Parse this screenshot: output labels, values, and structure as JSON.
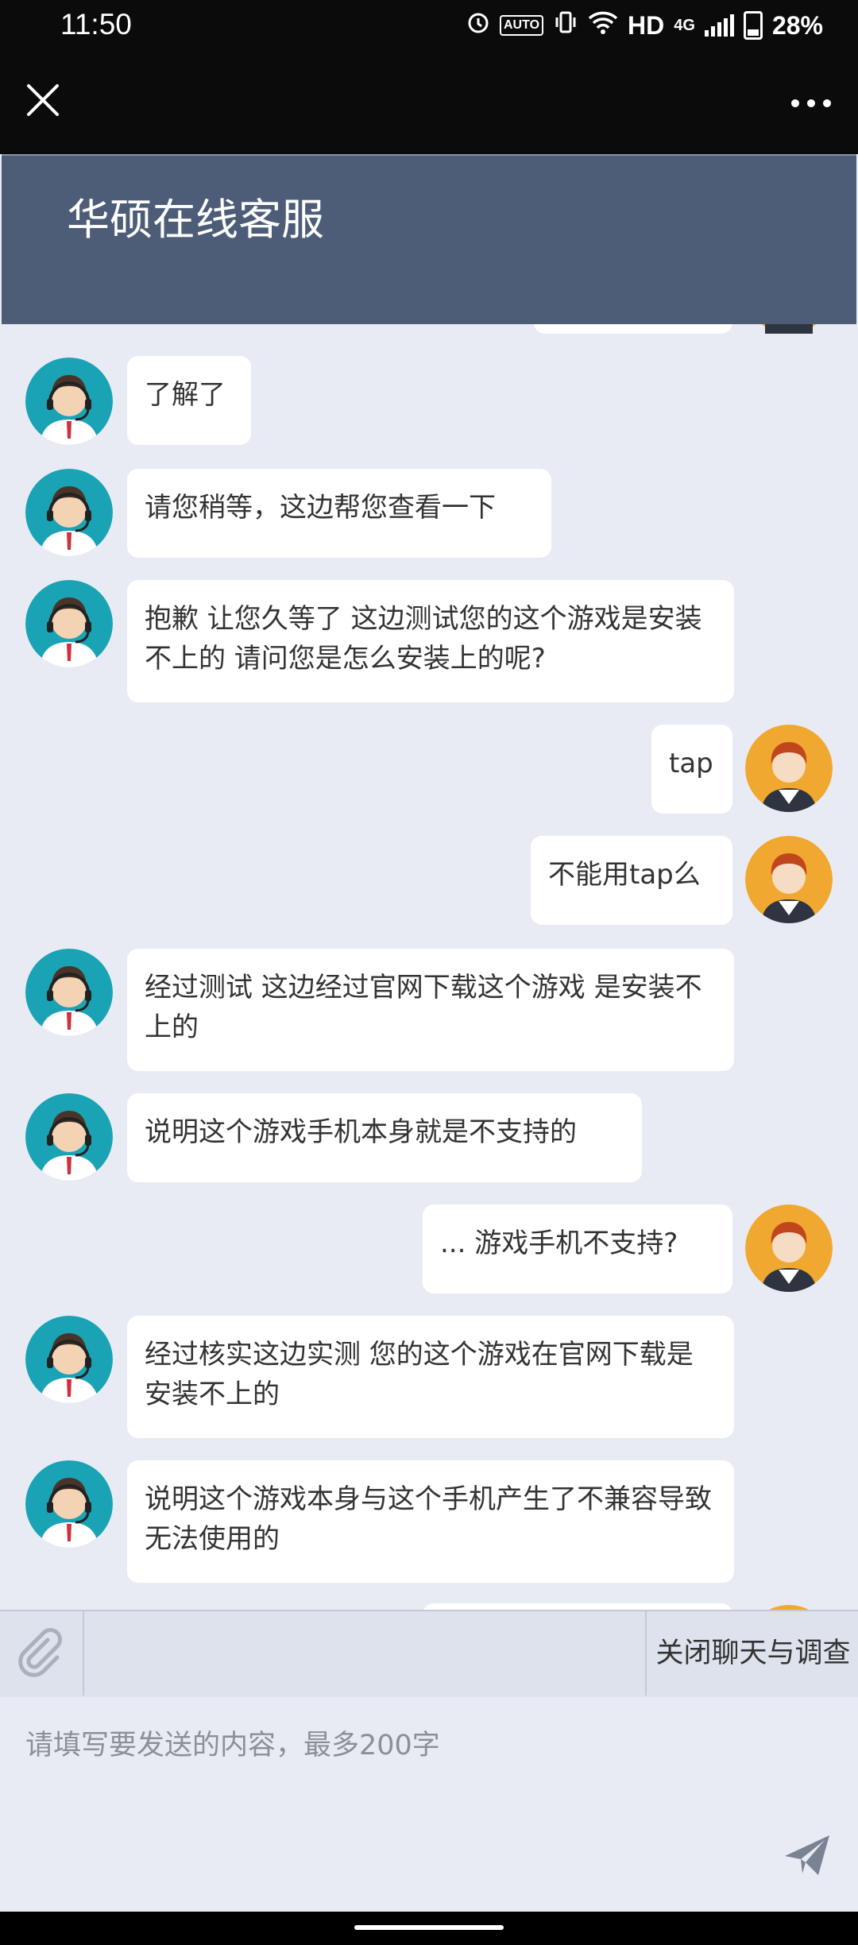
{
  "status_bar": {
    "time": "11:50",
    "icons": [
      "alarm-icon",
      "auto-hz-icon",
      "vibrate-icon",
      "wifi-icon",
      "signal-icon",
      "battery-icon"
    ],
    "auto_label": "AUTO",
    "hd": "HD",
    "network": "4G",
    "battery": "28%"
  },
  "app_bar": {
    "close_icon": "close-icon",
    "more_icon": "more-dots-icon"
  },
  "chat": {
    "title": "华硕在线客服",
    "messages": [
      {
        "from": "agent",
        "text": "了解了"
      },
      {
        "from": "agent",
        "text": "请您稍等，这边帮您查看一下"
      },
      {
        "from": "agent",
        "text": "抱歉 让您久等了 这边测试您的这个游戏是安装不上的 请问您是怎么安装上的呢?"
      },
      {
        "from": "user",
        "text": "tap"
      },
      {
        "from": "user",
        "text": "不能用tap么"
      },
      {
        "from": "agent",
        "text": "经过测试 这边经过官网下载这个游戏 是安装不上的"
      },
      {
        "from": "agent",
        "text": "说明这个游戏手机本身就是不支持的"
      },
      {
        "from": "user",
        "text": "... 游戏手机不支持?"
      },
      {
        "from": "agent",
        "text": "经过核实这边实测 您的这个游戏在官网下载是安装不上的"
      },
      {
        "from": "agent",
        "text": "说明这个游戏本身与这个手机产生了不兼容导致无法使用的"
      }
    ]
  },
  "toolbar": {
    "attach_icon": "paperclip-icon",
    "close_survey_label": "关闭聊天与调查"
  },
  "composer": {
    "placeholder": "请填写要发送的内容，最多200字",
    "send_icon": "send-icon"
  },
  "colors": {
    "header": "#4d5c77",
    "background": "#e8ebf4",
    "bubble": "#ffffff",
    "agent_avatar": "#1aa3b5",
    "user_avatar": "#f0a830"
  }
}
